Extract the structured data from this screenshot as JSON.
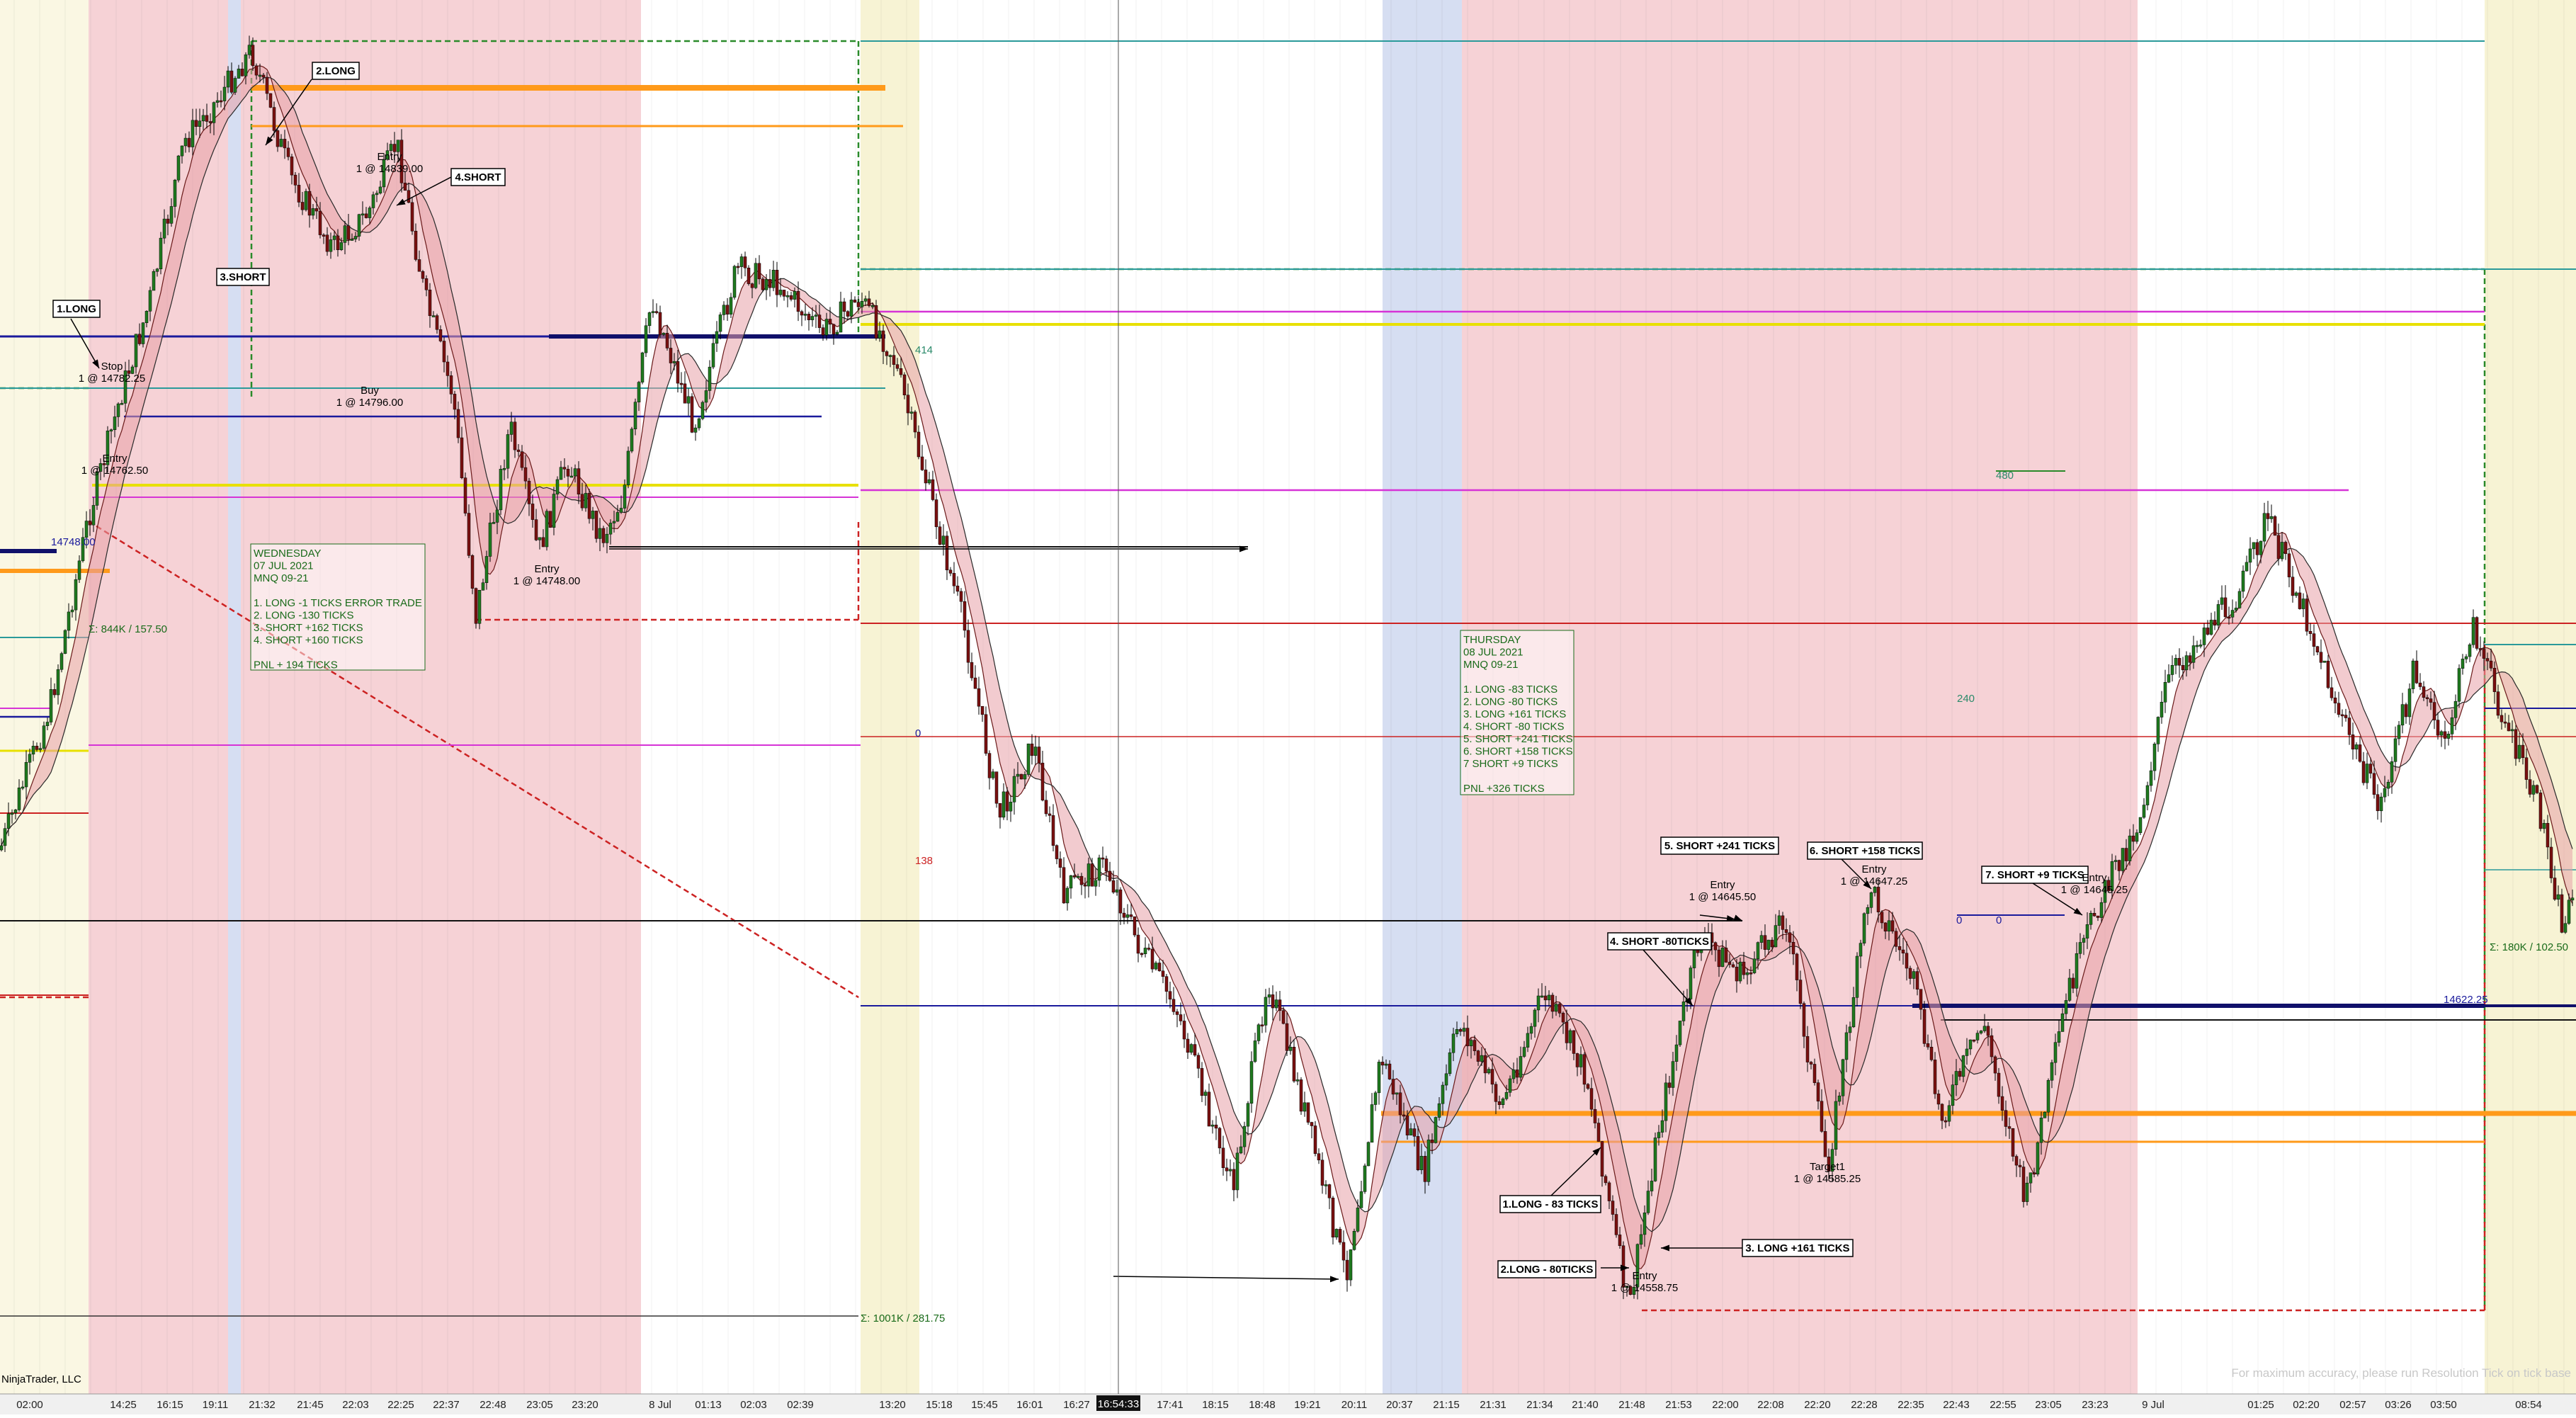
{
  "chart_data": {
    "type": "line",
    "title": "",
    "xlabel": "",
    "ylabel": "",
    "watermark": "NinjaTrader, LLC",
    "resolution_note": "For maximum accuracy, please run Resolution Tick on tick base",
    "cursor_time": "16:54:33",
    "x_tick_labels": [
      "02:00",
      "14:25",
      "16:15",
      "19:11",
      "21:32",
      "21:45",
      "22:03",
      "22:25",
      "22:37",
      "22:48",
      "23:05",
      "23:20",
      "8 Jul",
      "01:13",
      "02:03",
      "02:39",
      "13:20",
      "15:18",
      "15:45",
      "16:01",
      "16:27",
      "17:41",
      "18:15",
      "18:48",
      "19:21",
      "20:11",
      "20:37",
      "21:15",
      "21:31",
      "21:34",
      "21:40",
      "21:48",
      "21:53",
      "22:00",
      "22:08",
      "22:20",
      "22:28",
      "22:35",
      "22:43",
      "22:55",
      "23:05",
      "23:23",
      "9 Jul",
      "01:25",
      "02:20",
      "02:57",
      "03:26",
      "03:50",
      "08:54"
    ],
    "series": [
      {
        "name": "",
        "values": [
          14700,
          14740,
          14770,
          14800,
          14850,
          14880,
          14870,
          14840,
          14820,
          14790,
          14760,
          14750,
          14790,
          14800,
          14810,
          14805,
          14800,
          14760,
          14720,
          14690,
          14670,
          14640,
          14630,
          14620,
          14600,
          14580,
          14560,
          14600,
          14610,
          14620,
          14580,
          14570,
          14570,
          14600,
          14640,
          14610,
          14630,
          14600,
          14620,
          14580,
          14600,
          14640,
          14700,
          14720,
          14680,
          14690,
          14680,
          14670,
          14650
        ]
      }
    ],
    "price_markers": [
      "14748.00",
      "14622.25"
    ],
    "volume_notes": [
      "Σ: 844K / 157.50",
      "Σ: 1001K / 281.75",
      "Σ: 180K / 102.50"
    ],
    "small_levels": [
      "414",
      "138",
      "480",
      "240",
      "0",
      "0",
      "0"
    ],
    "trade_callouts": [
      {
        "label": "1.LONG"
      },
      {
        "label": "2.LONG"
      },
      {
        "label": "3.SHORT"
      },
      {
        "label": "4.SHORT"
      },
      {
        "label": "5. SHORT +241 TICKS"
      },
      {
        "label": "6. SHORT +158 TICKS"
      },
      {
        "label": "7. SHORT +9 TICKS"
      },
      {
        "label": "4. SHORT -80TICKS"
      },
      {
        "label": "1.LONG - 83 TICKS"
      },
      {
        "label": "2.LONG - 80TICKS"
      },
      {
        "label": "3. LONG +161 TICKS"
      }
    ],
    "fill_labels": [
      {
        "l1": "Entry",
        "l2": "1 @ 14839.00"
      },
      {
        "l1": "Buy",
        "l2": "1 @ 14796.00"
      },
      {
        "l1": "Entry",
        "l2": "1 @ 14748.00"
      },
      {
        "l1": "Stop",
        "l2": "1 @ 14782.25"
      },
      {
        "l1": "Entry",
        "l2": "1 @ 14762.50"
      },
      {
        "l1": "Entry",
        "l2": "1 @ 14645.50"
      },
      {
        "l1": "Entry",
        "l2": "1 @ 14647.25"
      },
      {
        "l1": "Entry",
        "l2": "1 @ 14645.25"
      },
      {
        "l1": "Target1",
        "l2": "1 @ 14585.25"
      },
      {
        "l1": "Entry",
        "l2": "1 @ 14558.75"
      }
    ],
    "notes": [
      {
        "lines": [
          "WEDNESDAY",
          "07 JUL 2021",
          "MNQ 09-21",
          "",
          "1. LONG -1 TICKS ERROR TRADE",
          "2. LONG -130 TICKS",
          "3. SHORT +162 TICKS",
          "4. SHORT +160 TICKS",
          "",
          "PNL + 194 TICKS"
        ]
      },
      {
        "lines": [
          "THURSDAY",
          "08 JUL 2021",
          "MNQ 09-21",
          "",
          "1. LONG -83 TICKS",
          "2. LONG -80 TICKS",
          "3. LONG +161 TICKS",
          "4. SHORT -80 TICKS",
          "5. SHORT +241 TICKS",
          "6. SHORT +158 TICKS",
          "7 SHORT +9 TICKS",
          "",
          "PNL +326  TICKS"
        ]
      }
    ],
    "colors": {
      "session_pink": "#f6d2d6",
      "session_yellow": "#f7f3d4",
      "session_blue": "#d6def2",
      "candle_up": "#1f7a1f",
      "candle_down": "#7a1010",
      "orange_level": "#ff9a1a",
      "magenta_level": "#d633d6",
      "yellow_level": "#e8e000",
      "navy_level": "#1a1a9c",
      "teal_level": "#2a9a9a",
      "red_box": "#cc2222",
      "green_box": "#2a8a2a",
      "note_text": "#1a6b1a"
    },
    "grid": true,
    "legend": "none"
  }
}
